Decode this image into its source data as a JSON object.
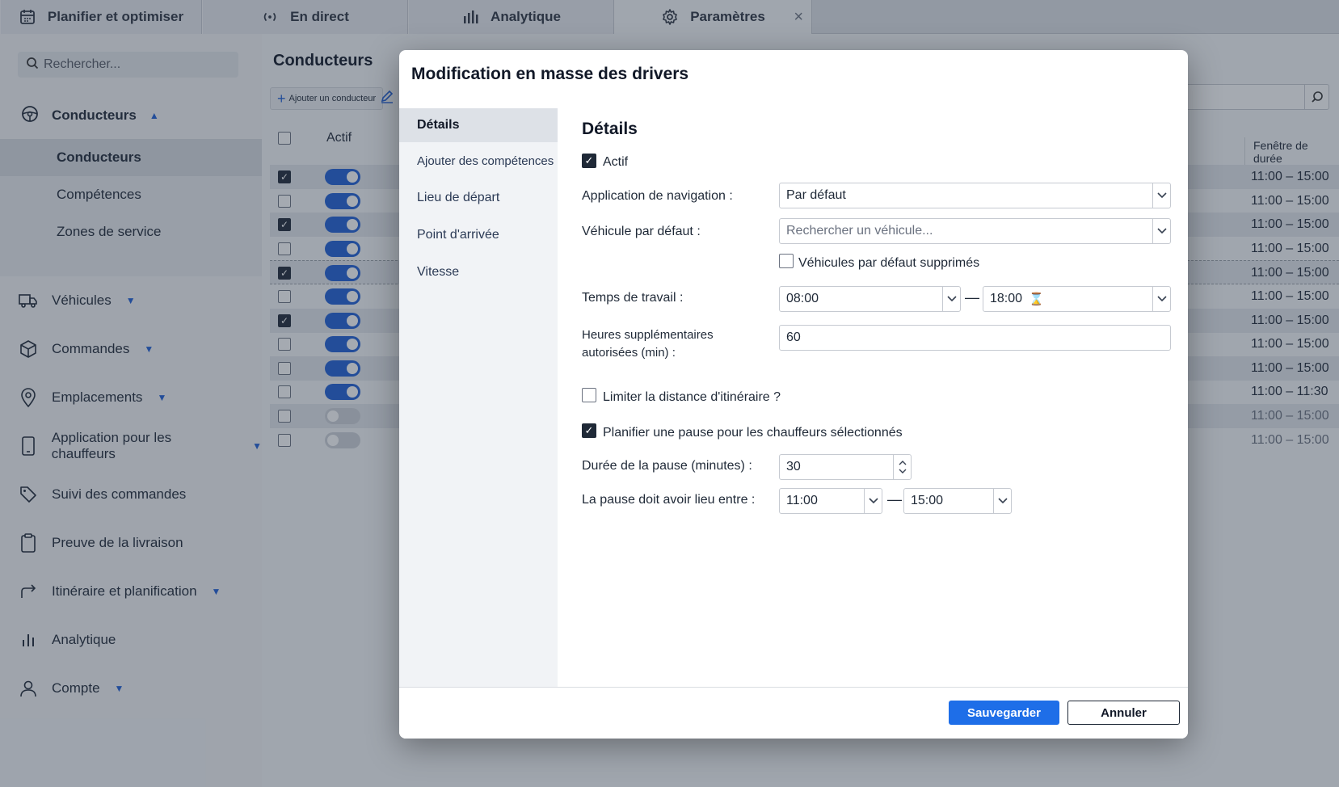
{
  "tabs": [
    {
      "label": "Planifier et optimiser",
      "icon": "calendar-icon"
    },
    {
      "label": "En direct",
      "icon": "broadcast-icon"
    },
    {
      "label": "Analytique",
      "icon": "bar-chart-icon"
    },
    {
      "label": "Paramètres",
      "icon": "gear-icon",
      "active": true
    }
  ],
  "sidebar": {
    "search_placeholder": "Rechercher...",
    "group_label": "Conducteurs",
    "subitems": [
      "Conducteurs",
      "Compétences",
      "Zones de service"
    ],
    "items": [
      {
        "label": "Véhicules",
        "icon": "truck-icon"
      },
      {
        "label": "Commandes",
        "icon": "box-icon"
      },
      {
        "label": "Emplacements",
        "icon": "location-pin-icon"
      },
      {
        "label": "Application pour les chauffeurs",
        "icon": "phone-icon"
      },
      {
        "label": "Suivi des commandes",
        "icon": "tag-icon"
      },
      {
        "label": "Preuve de la livraison",
        "icon": "clipboard-icon"
      },
      {
        "label": "Itinéraire et planification",
        "icon": "route-arrow-icon"
      },
      {
        "label": "Analytique",
        "icon": "bar-chart-icon"
      },
      {
        "label": "Compte",
        "icon": "user-icon"
      }
    ]
  },
  "main": {
    "title": "Conducteurs",
    "add_button": "Ajouter un conducteur",
    "col_actif": "Actif",
    "col_window": "Fenêtre de durée",
    "rows": [
      {
        "checked": true,
        "active": true,
        "window": "11:00 – 15:00"
      },
      {
        "checked": false,
        "active": true,
        "window": "11:00 – 15:00"
      },
      {
        "checked": true,
        "active": true,
        "window": "11:00 – 15:00"
      },
      {
        "checked": false,
        "active": true,
        "window": "11:00 – 15:00"
      },
      {
        "checked": true,
        "active": true,
        "window": "11:00 – 15:00"
      },
      {
        "checked": false,
        "active": true,
        "window": "11:00 – 15:00"
      },
      {
        "checked": true,
        "active": true,
        "window": "11:00 – 15:00"
      },
      {
        "checked": false,
        "active": true,
        "window": "11:00 – 15:00"
      },
      {
        "checked": false,
        "active": true,
        "window": "11:00 – 15:00"
      },
      {
        "checked": false,
        "active": true,
        "window": "11:00 – 11:30"
      },
      {
        "checked": false,
        "active": false,
        "window": "11:00 – 15:00"
      },
      {
        "checked": false,
        "active": false,
        "window": "11:00 – 15:00"
      }
    ]
  },
  "modal": {
    "title": "Modification en masse des drivers",
    "nav": [
      "Détails",
      "Ajouter des compétences",
      "Lieu de départ",
      "Point d'arrivée",
      "Vitesse"
    ],
    "section_title": "Détails",
    "actif_label": "Actif",
    "nav_app_label": "Application de navigation :",
    "nav_app_value": "Par défaut",
    "vehicle_label": "Véhicule par défaut :",
    "vehicle_placeholder": "Rechercher un véhicule...",
    "vehicle_deleted_label": "Véhicules par défaut supprimés",
    "work_time_label": "Temps de travail :",
    "work_start": "08:00",
    "work_end": "18:00",
    "work_end_icon": "⌛",
    "overtime_label_1": "Heures supplémentaires",
    "overtime_label_2": "autorisées (min) :",
    "overtime_value": "60",
    "limit_distance_label": "Limiter la distance d'itinéraire ?",
    "plan_break_label": "Planifier une pause pour les chauffeurs sélectionnés",
    "break_duration_label": "Durée de la pause (minutes) :",
    "break_duration_value": "30",
    "break_between_label": "La pause doit avoir lieu entre :",
    "break_start": "11:00",
    "break_end": "15:00",
    "save": "Sauvegarder",
    "cancel": "Annuler"
  },
  "colors": {
    "accent": "#1e6ee8",
    "toggle_on": "#1f5fd6"
  }
}
